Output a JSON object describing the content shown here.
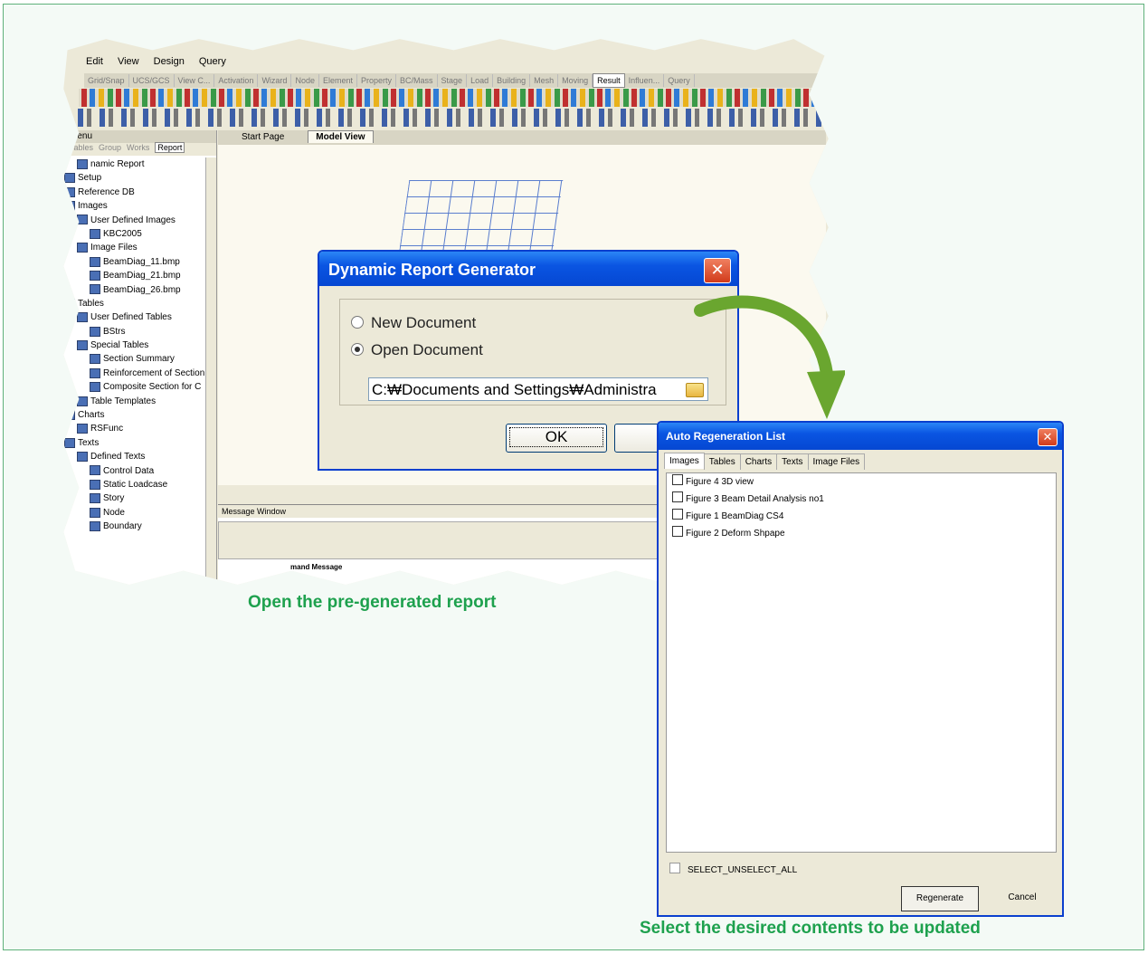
{
  "app": {
    "menus": [
      "Edit",
      "View",
      "Design",
      "Query"
    ],
    "ribbon_tabs": [
      "Grid/Snap",
      "UCS/GCS",
      "View C...",
      "Activation",
      "Wizard",
      "Node",
      "Element",
      "Property",
      "BC/Mass",
      "Stage",
      "Load",
      "Building",
      "Mesh",
      "Moving",
      "Result",
      "Influen...",
      "Query"
    ],
    "active_ribbon_tab": "Result",
    "tree_panel_title": "Menu",
    "tree_tabs": [
      "Tables",
      "Group",
      "Works",
      "Report"
    ],
    "active_tree_tab": "Report",
    "tree_items": [
      {
        "label": "namic Report",
        "indent": 1
      },
      {
        "label": "Setup",
        "indent": 0
      },
      {
        "label": "Reference DB",
        "indent": 0
      },
      {
        "label": "Images",
        "indent": 0
      },
      {
        "label": "User Defined Images",
        "indent": 1
      },
      {
        "label": "KBC2005",
        "indent": 2
      },
      {
        "label": "Image Files",
        "indent": 1
      },
      {
        "label": "BeamDiag_11.bmp",
        "indent": 2
      },
      {
        "label": "BeamDiag_21.bmp",
        "indent": 2
      },
      {
        "label": "BeamDiag_26.bmp",
        "indent": 2
      },
      {
        "label": "Tables",
        "indent": 0
      },
      {
        "label": "User Defined Tables",
        "indent": 1
      },
      {
        "label": "BStrs",
        "indent": 2
      },
      {
        "label": "Special Tables",
        "indent": 1
      },
      {
        "label": "Section Summary",
        "indent": 2
      },
      {
        "label": "Reinforcement of Section",
        "indent": 2
      },
      {
        "label": "Composite Section for C",
        "indent": 2
      },
      {
        "label": "Table Templates",
        "indent": 1
      },
      {
        "label": "Charts",
        "indent": 0
      },
      {
        "label": "RSFunc",
        "indent": 1
      },
      {
        "label": "Texts",
        "indent": 0
      },
      {
        "label": "Defined Texts",
        "indent": 1
      },
      {
        "label": "Control Data",
        "indent": 2
      },
      {
        "label": "Static Loadcase",
        "indent": 2
      },
      {
        "label": "Story",
        "indent": 2
      },
      {
        "label": "Node",
        "indent": 2
      },
      {
        "label": "Boundary",
        "indent": 2
      }
    ],
    "view_tabs": [
      "Start Page",
      "Model View"
    ],
    "active_view_tab": "Model View",
    "message_window_title": "Message Window",
    "message_tab": "mand Message"
  },
  "drg": {
    "title": "Dynamic Report Generator",
    "close": "✕",
    "options": [
      {
        "label": "New Document",
        "selected": false
      },
      {
        "label": "Open Document",
        "selected": true
      }
    ],
    "path": "C:₩Documents and Settings₩Administra",
    "ok": "OK",
    "cancel": "C"
  },
  "arl": {
    "title": "Auto Regeneration List",
    "close": "✕",
    "tabs": [
      "Images",
      "Tables",
      "Charts",
      "Texts",
      "Image Files"
    ],
    "active_tab": "Images",
    "items": [
      {
        "label": "Figure 4 3D view",
        "checked": false
      },
      {
        "label": "Figure 3 Beam Detail Analysis no1",
        "checked": false
      },
      {
        "label": "Figure 1 BeamDiag CS4",
        "checked": false
      },
      {
        "label": "Figure 2 Deform Shpape",
        "checked": false
      }
    ],
    "select_all": "SELECT_UNSELECT_ALL",
    "regenerate": "Regenerate",
    "cancel": "Cancel"
  },
  "captions": {
    "open_report": "Open the pre-generated report",
    "select_contents": "Select the desired contents to be updated"
  },
  "colors": {
    "caption": "#1ea14e",
    "xp_title": "#0a55e2",
    "frame_border": "#5fb17b",
    "arrow": "#6aa62f"
  }
}
